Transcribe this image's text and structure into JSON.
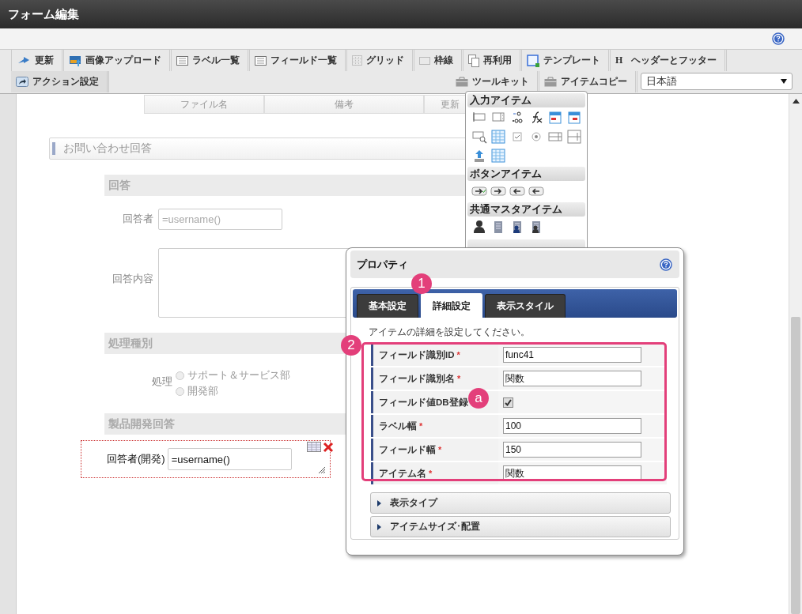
{
  "window": {
    "title": "フォーム編集"
  },
  "toolbar": {
    "row_1": [
      {
        "label": "更新"
      },
      {
        "label": "画像アップロード"
      },
      {
        "label": "ラベル一覧"
      },
      {
        "label": "フィールド一覧"
      },
      {
        "label": "グリッド"
      },
      {
        "label": "枠線"
      },
      {
        "label": "再利用"
      },
      {
        "label": "テンプレート"
      },
      {
        "label": "ヘッダーとフッター",
        "icon_text": "H"
      }
    ],
    "row_2_left": [
      {
        "label": "アクション設定"
      }
    ],
    "row_2_right": [
      {
        "label": "ツールキット"
      },
      {
        "label": "アイテムコピー"
      }
    ],
    "language": {
      "value": "日本語"
    }
  },
  "file_table": {
    "columns": [
      "ファイル名",
      "備考",
      "更新"
    ]
  },
  "form": {
    "section": "お問い合わせ回答",
    "groups": [
      {
        "title": "回答",
        "fields": [
          {
            "kind": "input",
            "label": "回答者",
            "placeholder": "=username()"
          },
          {
            "kind": "textarea",
            "label": "回答内容"
          }
        ]
      },
      {
        "title": "処理種別",
        "fields": [
          {
            "kind": "radio",
            "label": "処理",
            "options": [
              {
                "label": "サポート＆サービス部",
                "selected": false
              },
              {
                "label": "開発部",
                "selected": false
              }
            ]
          }
        ]
      },
      {
        "title": "製品開発回答",
        "fields": [
          {
            "kind": "selected-input",
            "label": "回答者(開発)",
            "value": "=username()"
          }
        ]
      }
    ]
  },
  "palette": {
    "sections": [
      {
        "title": "入力アイテム"
      },
      {
        "title": "ボタンアイテム"
      },
      {
        "title": "共通マスタアイテム"
      }
    ]
  },
  "properties": {
    "title": "プロパティ",
    "tabs": [
      {
        "label": "基本設定",
        "selected": false
      },
      {
        "label": "詳細設定",
        "selected": true
      },
      {
        "label": "表示スタイル",
        "selected": false
      }
    ],
    "description": "アイテムの詳細を設定してください。",
    "rows": [
      {
        "kind": "text",
        "label": "フィールド識別ID",
        "required_mark": "*",
        "value": "func41"
      },
      {
        "kind": "text",
        "label": "フィールド識別名",
        "required_mark": "*",
        "value": "関数"
      },
      {
        "kind": "checkbox",
        "label": "フィールド値DB登録",
        "checked": true
      },
      {
        "kind": "text",
        "label": "ラベル幅",
        "required_mark": "*",
        "value": "100"
      },
      {
        "kind": "text",
        "label": "フィールド幅",
        "required_mark": "*",
        "value": "150"
      },
      {
        "kind": "text",
        "label": "アイテム名",
        "required_mark": "*",
        "value": "関数"
      }
    ],
    "sections": [
      {
        "label": "表示タイプ",
        "expanded": false
      },
      {
        "label": "アイテムサイズ･配置",
        "expanded": false
      }
    ]
  },
  "callouts": [
    "1",
    "2",
    "a"
  ]
}
